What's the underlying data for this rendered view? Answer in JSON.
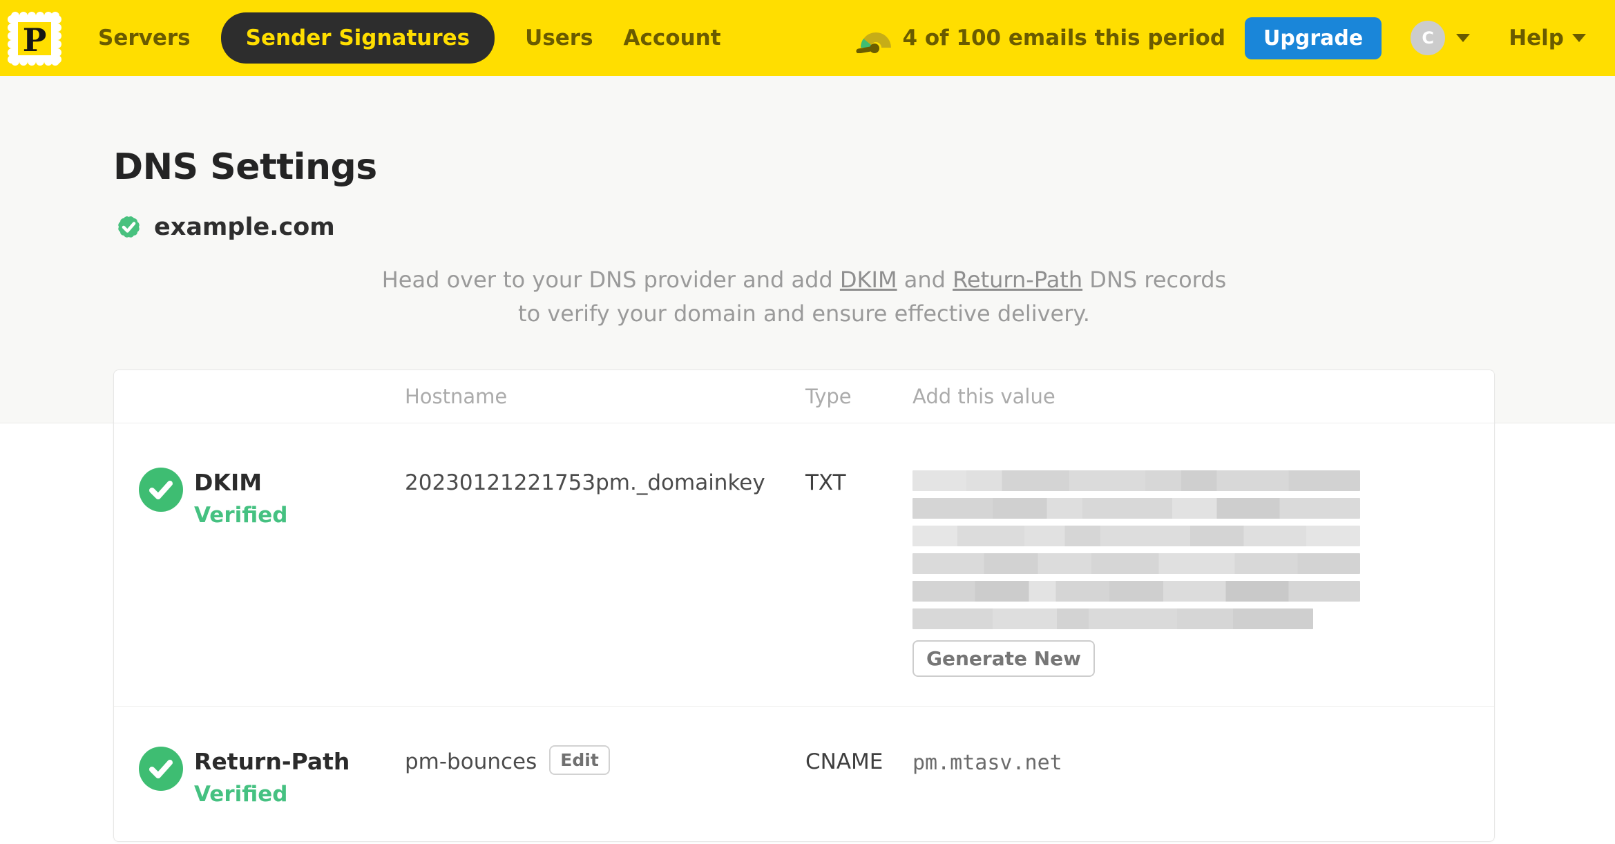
{
  "nav": {
    "logo_letter": "P",
    "items": [
      {
        "label": "Servers",
        "active": false
      },
      {
        "label": "Sender Signatures",
        "active": true
      },
      {
        "label": "Users",
        "active": false
      },
      {
        "label": "Account",
        "active": false
      }
    ],
    "usage_label": "4 of 100 emails this period",
    "upgrade_label": "Upgrade",
    "avatar_initial": "C",
    "help_label": "Help"
  },
  "page": {
    "title": "DNS Settings",
    "domain": "example.com",
    "intro": {
      "pre": "Head over to your DNS provider and add ",
      "link1": "DKIM",
      "mid": " and ",
      "link2": "Return-Path",
      "post": " DNS records to verify your domain and ensure effective delivery."
    }
  },
  "table": {
    "headers": [
      "Hostname",
      "Type",
      "Add this value"
    ],
    "rows": [
      {
        "name": "DKIM",
        "status": "Verified",
        "hostname": "20230121221753pm._domainkey",
        "type": "TXT",
        "value_redacted": true,
        "action_label": "Generate New"
      },
      {
        "name": "Return-Path",
        "status": "Verified",
        "hostname": "pm-bounces",
        "edit_label": "Edit",
        "type": "CNAME",
        "value": "pm.mtasv.net"
      }
    ]
  },
  "colors": {
    "brand_yellow": "#ffde00",
    "upgrade_blue": "#1a86d9",
    "verified_green": "#45c181",
    "nav_active_bg": "#2d2d2d"
  }
}
